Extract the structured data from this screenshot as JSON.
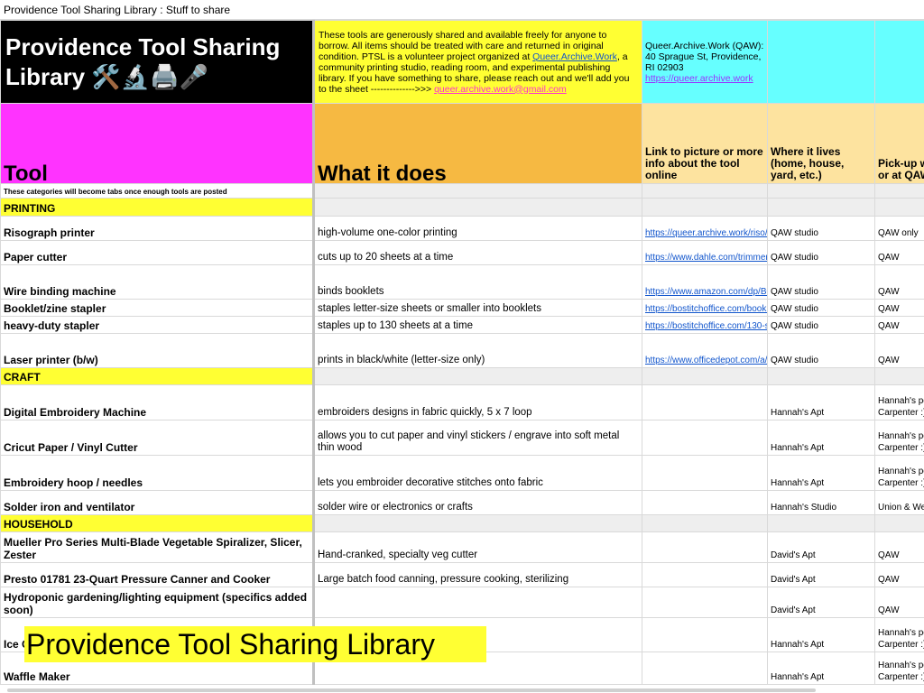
{
  "window": {
    "title": "Providence Tool Sharing Library : Stuff to share"
  },
  "header": {
    "title": "Providence Tool Sharing Library 🛠️🔬🖨️🎤",
    "intro_text_1": "These tools are generously shared and available freely for anyone to borrow. All items should be treated with care and returned in original condition. PTSL is a volunteer project organized at ",
    "intro_link_1": "Queer.Archive.Work",
    "intro_text_2": ", a community printing studio, reading room, and experimental publishing library. If you have something to share, please reach out and we'll add you to the sheet -------------->>> ",
    "intro_link_2": "queer.archive.work@gmail.com",
    "address": "Queer.Archive.Work (QAW): 40 Sprague St, Providence, RI 02903",
    "address_link": "https://queer.archive.work"
  },
  "columns": {
    "tool": "Tool",
    "what": "What it does",
    "link": "Link to picture or more info about the tool online",
    "lives": "Where it lives (home, house, yard, etc.)",
    "pickup": "Pick-up where it lives or at QAW?"
  },
  "note": "These categories will become tabs once enough tools are posted",
  "categories": {
    "printing": "PRINTING",
    "craft": "CRAFT",
    "household": "HOUSEHOLD"
  },
  "rows": {
    "printing": [
      {
        "tool": "Risograph printer",
        "what": "high-volume one-color printing",
        "link": "https://queer.archive.work/riso/i",
        "lives": "QAW studio",
        "pickup": "QAW only"
      },
      {
        "tool": "Paper cutter",
        "what": "cuts up to 20 sheets at a time",
        "link": "https://www.dahle.com/trimmer/",
        "lives": "QAW studio",
        "pickup": "QAW"
      },
      {
        "tool": "Wire binding machine",
        "what": "binds booklets",
        "link": "https://www.amazon.com/dp/B0",
        "lives": "QAW studio",
        "pickup": "QAW"
      },
      {
        "tool": "Booklet/zine stapler",
        "what": "staples letter-size sheets or smaller into booklets",
        "link": "https://bostitchoffice.com/booklet",
        "lives": "QAW studio",
        "pickup": "QAW"
      },
      {
        "tool": "heavy-duty stapler",
        "what": "staples up to 130 sheets at a time",
        "link": "https://bostitchoffice.com/130-s",
        "lives": "QAW studio",
        "pickup": "QAW"
      },
      {
        "tool": "Laser printer (b/w)",
        "what": "prints in black/white (letter-size only)",
        "link": "https://www.officedepot.com/a/p",
        "lives": "QAW studio",
        "pickup": "QAW"
      }
    ],
    "craft": [
      {
        "tool": "Digital Embroidery Machine",
        "what": "embroiders designs in fabric quickly, 5 x 7 loop",
        "link": "",
        "lives": "Hannah's Apt",
        "pickup": "Hannah's porch Battey & Carpenter :)"
      },
      {
        "tool": "Cricut Paper / Vinyl Cutter",
        "what": "allows you to cut paper and vinyl stickers / engrave into soft metal thin wood",
        "link": "",
        "lives": "Hannah's Apt",
        "pickup": "Hannah's porch Battey & Carpenter :)"
      },
      {
        "tool": "Embroidery hoop / needles",
        "what": "lets you embroider decorative stitches onto fabric",
        "link": "",
        "lives": "Hannah's Apt",
        "pickup": "Hannah's porch Battey & Carpenter :)"
      },
      {
        "tool": "Solder iron and ventilator",
        "what": "solder wire or electronics or crafts",
        "link": "",
        "lives": "Hannah's Studio",
        "pickup": "Union & Weybosset"
      }
    ],
    "household": [
      {
        "tool": "Mueller Pro Series Multi-Blade Vegetable Spiralizer, Slicer, Zester",
        "what": "Hand-cranked, specialty veg cutter",
        "link": "",
        "lives": "David's Apt",
        "pickup": "QAW"
      },
      {
        "tool": "Presto 01781 23-Quart Pressure Canner and Cooker",
        "what": "Large batch food canning, pressure cooking, sterilizing",
        "link": "",
        "lives": "David's Apt",
        "pickup": "QAW"
      },
      {
        "tool": "Hydroponic gardening/lighting equipment (specifics added soon)",
        "what": "",
        "link": "",
        "lives": "David's Apt",
        "pickup": "QAW"
      },
      {
        "tool": "Ice Cream Maker",
        "what": "",
        "link": "",
        "lives": "Hannah's Apt",
        "pickup": "Hannah's porch Battey & Carpenter :)"
      },
      {
        "tool": "Waffle Maker",
        "what": "",
        "link": "",
        "lives": "Hannah's Apt",
        "pickup": "Hannah's porch Battey & Carpenter :)"
      }
    ]
  },
  "overlay": {
    "title": "Providence Tool Sharing Library"
  },
  "colors": {
    "black": "#000000",
    "yellow": "#ffff33",
    "cyan": "#66ffff",
    "magenta": "#ff33ff",
    "orange": "#f6b942",
    "light_orange": "#fde39f"
  }
}
